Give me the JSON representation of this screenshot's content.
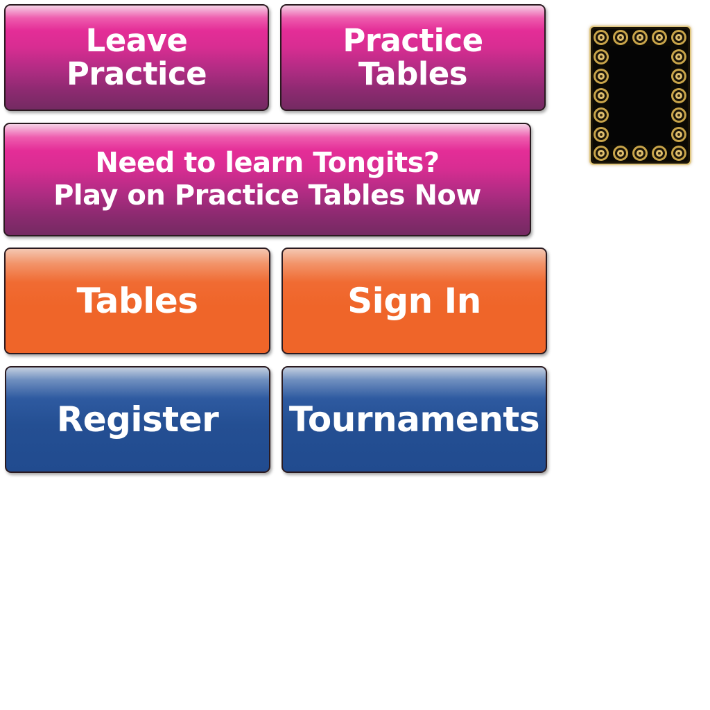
{
  "buttons": {
    "leave_practice": {
      "line1": "Leave",
      "line2": "Practice"
    },
    "practice_tables": {
      "line1": "Practice",
      "line2": "Tables"
    },
    "need_to_learn": {
      "line1": "Need to learn Tongits?",
      "line2": "Play on Practice Tables Now"
    },
    "tables": {
      "label": "Tables"
    },
    "sign_in": {
      "label": "Sign In"
    },
    "register": {
      "label": "Register"
    },
    "tournaments": {
      "label": "Tournaments"
    }
  },
  "card_back": {
    "icon": "ornate-card-back-icon",
    "border_color": "#c9a54a",
    "center_color": "#050505"
  },
  "colors": {
    "pink": "#e42d97",
    "orange": "#ef6529",
    "blue": "#244f93",
    "text": "#ffffff"
  }
}
